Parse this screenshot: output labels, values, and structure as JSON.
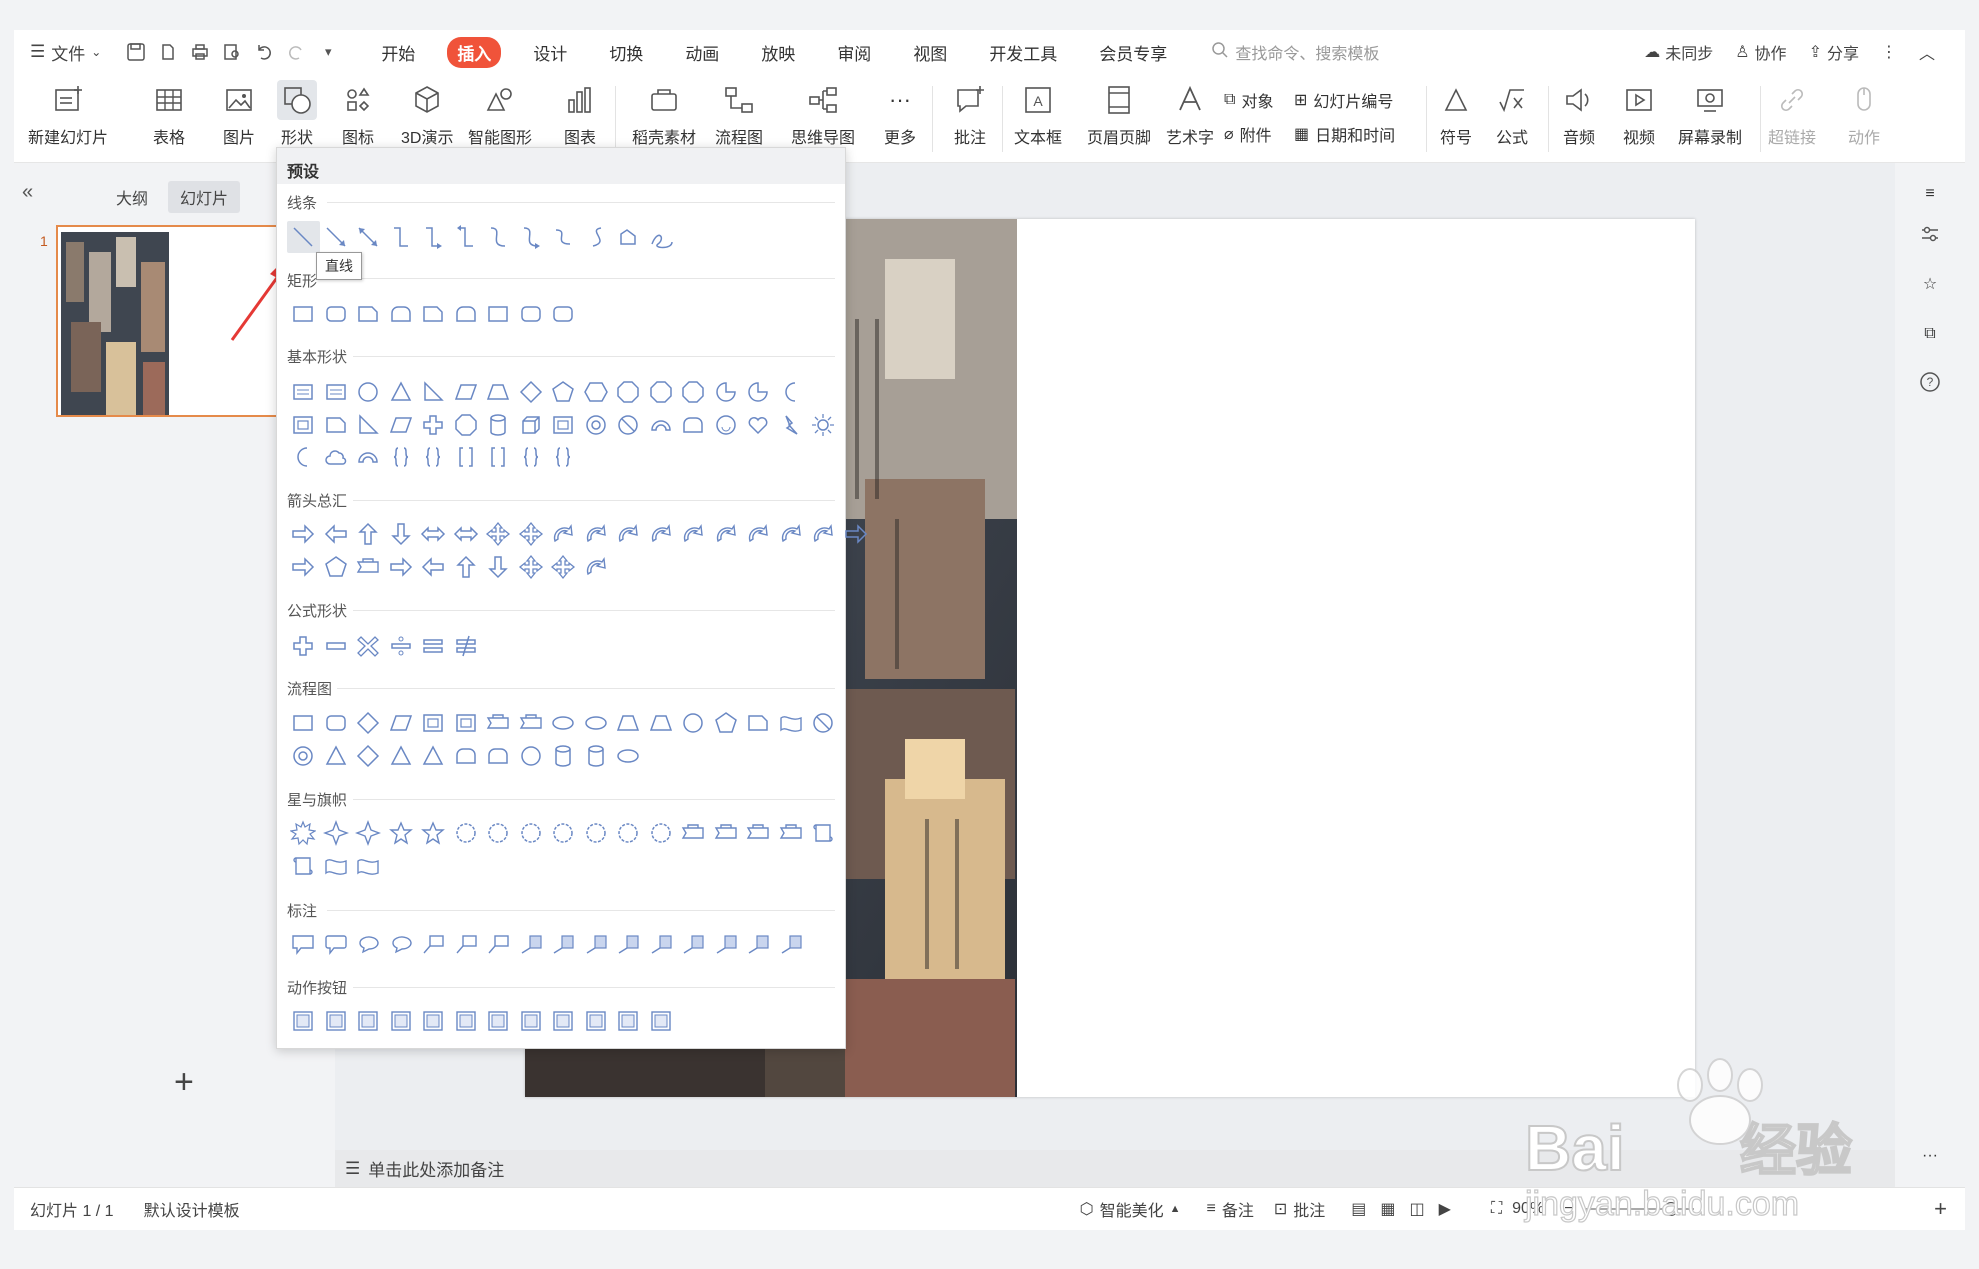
{
  "menubar": {
    "file_label": "文件",
    "tabs": [
      "开始",
      "插入",
      "设计",
      "切换",
      "动画",
      "放映",
      "审阅",
      "视图",
      "开发工具",
      "会员专享"
    ],
    "active_tab": "插入",
    "search_placeholder": "查找命令、搜索模板",
    "sync_label": "未同步",
    "collab_label": "协作",
    "share_label": "分享"
  },
  "ribbon": {
    "new_slide": "新建幻灯片",
    "table": "表格",
    "picture": "图片",
    "shape": "形状",
    "icon": "图标",
    "three_d": "3D演示",
    "smart_graphic": "智能图形",
    "chart": "图表",
    "material": "稻壳素材",
    "flowchart": "流程图",
    "mindmap": "思维导图",
    "more": "更多",
    "comment": "批注",
    "textbox": "文本框",
    "header_footer": "页眉页脚",
    "wordart": "艺术字",
    "object": "对象",
    "slide_number": "幻灯片编号",
    "attachment": "附件",
    "datetime": "日期和时间",
    "symbol": "符号",
    "formula": "公式",
    "audio": "音频",
    "video": "视频",
    "screen_record": "屏幕录制",
    "hyperlink": "超链接",
    "action": "动作"
  },
  "left_panel": {
    "outline_tab": "大纲",
    "slides_tab": "幻灯片",
    "slide_number": "1"
  },
  "shapes_menu": {
    "title": "预设",
    "tooltip": "直线",
    "sections": [
      "线条",
      "矩形",
      "基本形状",
      "箭头总汇",
      "公式形状",
      "流程图",
      "星与旗帜",
      "标注",
      "动作按钮"
    ]
  },
  "notes": {
    "placeholder": "单击此处添加备注"
  },
  "status": {
    "slide_info": "幻灯片 1 / 1",
    "template": "默认设计模板",
    "beautify": "智能美化",
    "notes": "备注",
    "comments": "批注",
    "zoom": "90%"
  },
  "watermark": {
    "brand": "Bai",
    "brand2": "经验",
    "url": "jingyan.baidu.com"
  },
  "colors": {
    "accent": "#f0533a",
    "shape_stroke": "#6a88c4",
    "selection": "#e58a4a"
  }
}
